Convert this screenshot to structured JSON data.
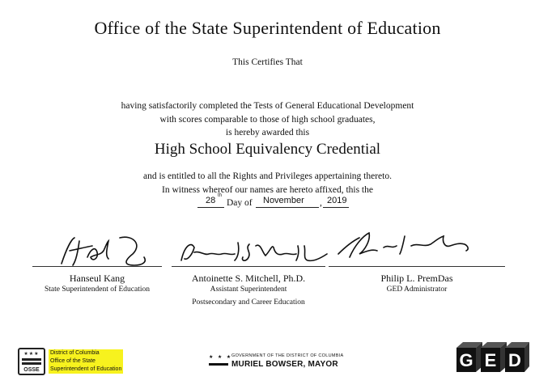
{
  "certificate": {
    "title": "Office of the State Superintendent of Education",
    "certifies": "This Certifies That",
    "line1": "having satisfactorily completed the Tests of General Educational Development",
    "line2": "with scores comparable to those of high school graduates,",
    "line3": "is hereby awarded this",
    "credential": "High School Equivalency Credential",
    "line4": "and is entitled to all the Rights and Privileges appertaining thereto.",
    "line5": "In witness whereof our names are hereto affixed, this the",
    "day_word": "Day of",
    "comma": ",",
    "day_value": "28",
    "day_suffix": "th",
    "month_value": "November",
    "year_value": "2019"
  },
  "signatories": [
    {
      "name": "Hanseul Kang",
      "role1": "State Superintendent of Education",
      "role2": ""
    },
    {
      "name": "Antoinette S. Mitchell, Ph.D.",
      "role1": "Assistant Superintendent",
      "role2": "Postsecondary and Career Education"
    },
    {
      "name": "Philip L. PremDas",
      "role1": "GED Administrator",
      "role2": ""
    }
  ],
  "footer": {
    "osse_logo_text": "OSSE",
    "osse_name_lines": [
      "District of Columbia",
      "Office of the State",
      "Superintendent of Education"
    ],
    "gov_small": "GOVERNMENT OF THE DISTRICT OF COLUMBIA",
    "gov_big": "MURIEL BOWSER, MAYOR",
    "ged_letters": [
      "G",
      "E",
      "D"
    ]
  },
  "colors": {
    "highlight": "#f7f21e",
    "ink": "#111111"
  }
}
